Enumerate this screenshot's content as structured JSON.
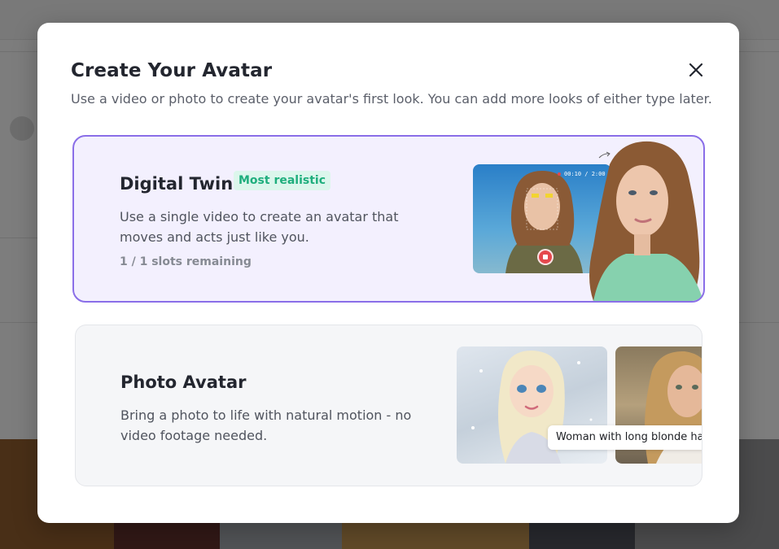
{
  "modal": {
    "title": "Create Your Avatar",
    "subtitle": "Use a video or photo to create your avatar's first look. You can add more looks of either type later.",
    "close_icon": "close-icon"
  },
  "digital_twin": {
    "title": "Digital Twin",
    "badge": "Most realistic",
    "description": "Use a single video to create an avatar that moves and acts just like you.",
    "slots": "1 / 1 slots remaining",
    "timer": "00:10 / 2:00"
  },
  "photo_avatar": {
    "title": "Photo Avatar",
    "description": "Bring a photo to life with natural motion - no video footage needed.",
    "caption": "Woman with long blonde hair"
  },
  "colors": {
    "selected_border": "#8a6ee8",
    "selected_bg": "#f3f0fe",
    "badge_text": "#1fae7d",
    "badge_bg": "#dcf6ec",
    "record": "#e5484d"
  }
}
